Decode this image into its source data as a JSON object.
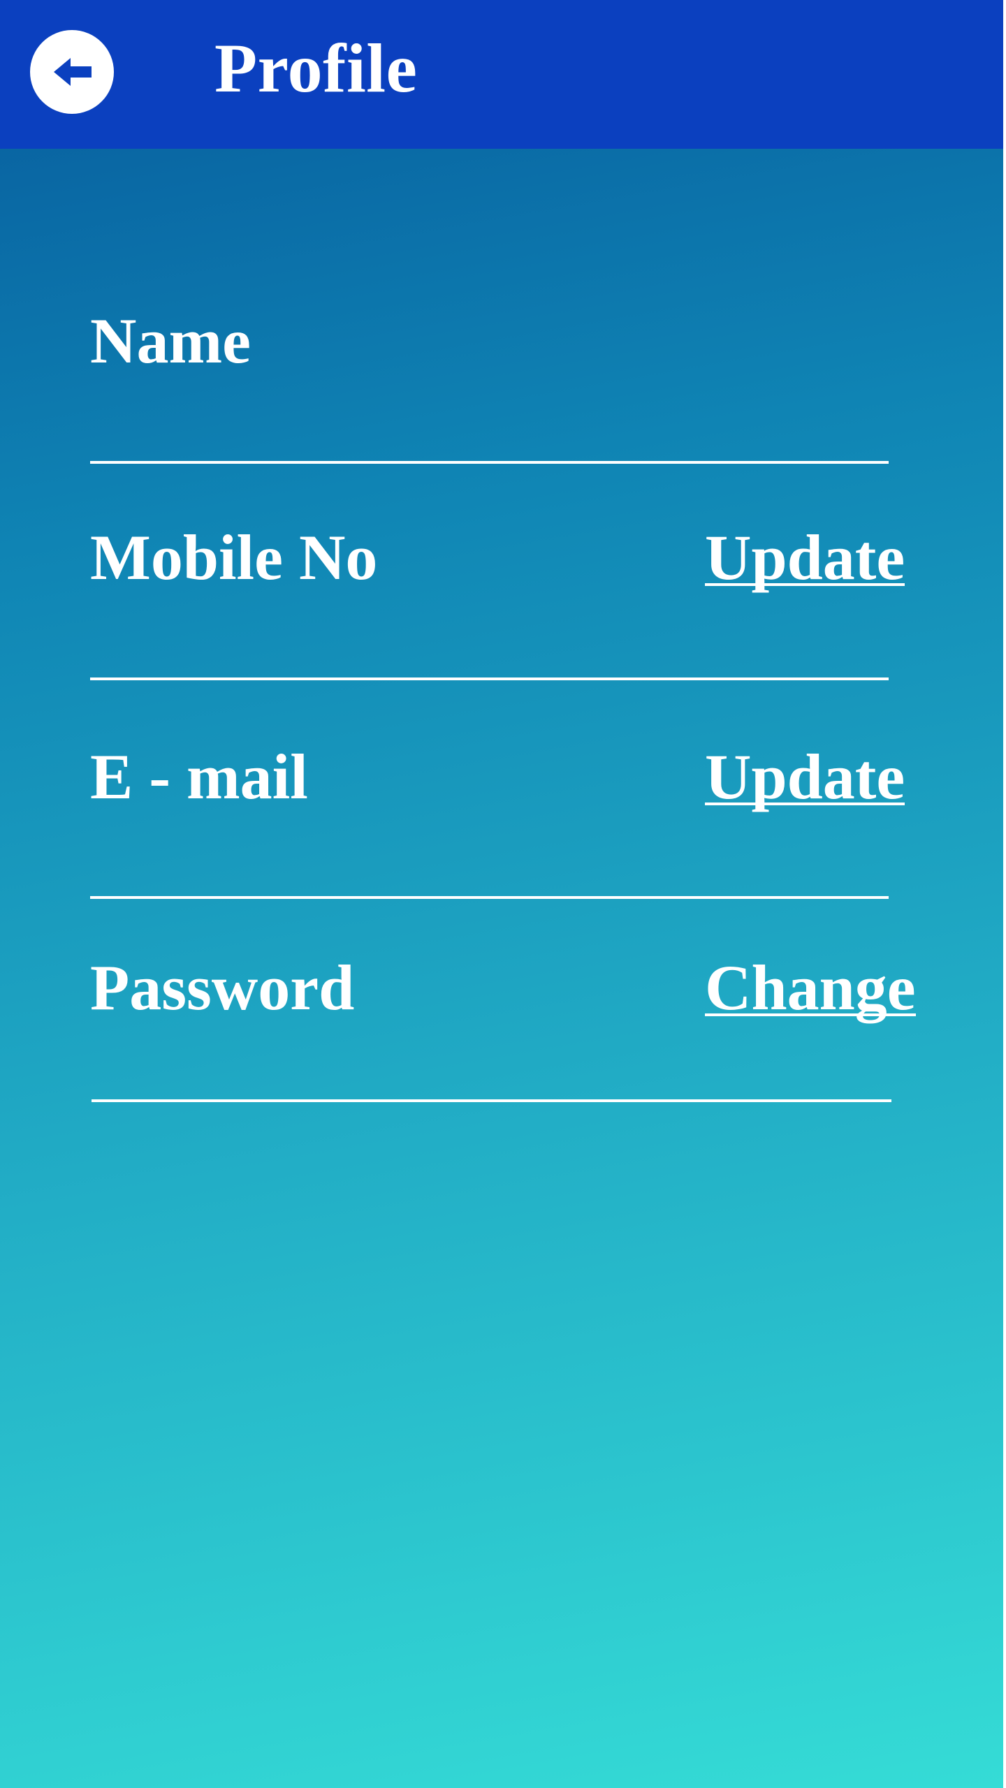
{
  "header": {
    "title": "Profile",
    "back_icon": "arrow-left-icon",
    "background_color": "#0b40bf"
  },
  "profile_fields": [
    {
      "label": "Name",
      "action": ""
    },
    {
      "label": "Mobile No",
      "action": "Update"
    },
    {
      "label": "E - mail",
      "action": "Update"
    },
    {
      "label": "Password",
      "action": "Change"
    }
  ],
  "colors": {
    "gradient_top": "#075a9c",
    "gradient_bottom": "#35dcd6",
    "text": "#ffffff"
  }
}
